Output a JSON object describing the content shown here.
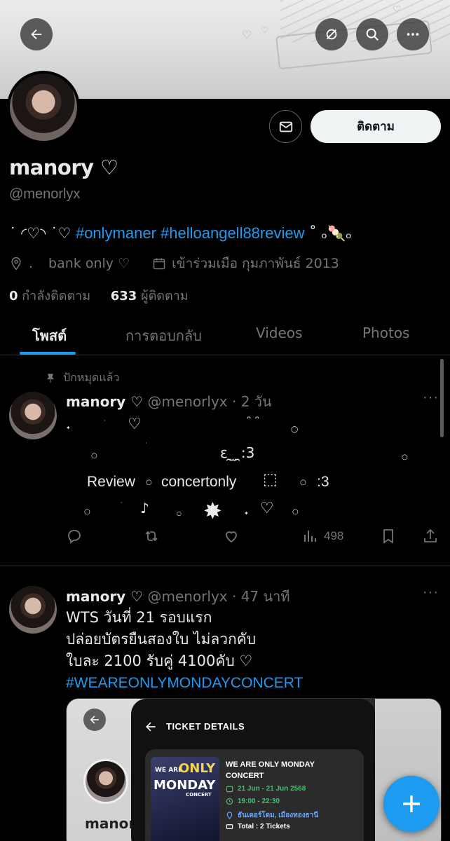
{
  "profile": {
    "name": "manory ♡",
    "handle": "@menorlyx",
    "bio_prefix": "˙ ◜♡◝ ˙♡ ",
    "bio_tag": "#onlymaner #helloangell88review",
    "bio_suffix": " ˚ ₒ🍡ₒ",
    "location": "bank only ♡",
    "joined": "เข้าร่วมเมือ กุมภาพันธ์ 2013",
    "following_count": "0",
    "following_label": "กำลังติดตาม",
    "followers_count": "633",
    "followers_label": "ผู้ติดตาม"
  },
  "buttons": {
    "follow": "ติดตาม"
  },
  "tabs": [
    {
      "label": "โพสต์",
      "active": true
    },
    {
      "label": "การตอบกลับ",
      "active": false
    },
    {
      "label": "Videos",
      "active": false
    },
    {
      "label": "Photos",
      "active": false
    }
  ],
  "posts": [
    {
      "pinned_label": "ปักหมุดแล้ว",
      "name": "manory ♡",
      "handle_time": "@menorlyx · 2 วัน",
      "deco_line1": "♡",
      "deco_line2": "ε ̯ ̫ ̯:3",
      "text_review": "Review",
      "text_concert": "concertonly",
      "text_end": ":3",
      "deco_line4": "♪",
      "deco_heart": "♡",
      "views": "498"
    },
    {
      "name": "manory ♡",
      "handle_time": "@menorlyx · 47 นาที",
      "lines": [
        "WTS วันที่ 21 รอบแรก",
        "ปล่อยบัตรยืนสองใบ ไม่ลวกคับ",
        "ใบละ 2100 รับคู่ 4100คับ ♡"
      ],
      "hashtag": "#WEAREONLYMONDAYCONCERT",
      "media": {
        "header": "TICKET DETAILS",
        "event_title": "WE ARE ONLY MONDAY CONCERT",
        "dates": "21 Jun - 21 Jun 2568",
        "time": "19:00 - 22:30",
        "venue": "ธันเดอร์โดม, เมืองทองธานี",
        "total": "Total : 2 Tickets",
        "poster_text_1": "WE ARE",
        "poster_text_2": "ONLY",
        "poster_text_3": "MONDAY",
        "poster_text_4": "CONCERT",
        "bg_name": "manory"
      }
    }
  ],
  "colors": {
    "accent": "#1d9bf0",
    "muted": "#71767b",
    "text": "#e7e9ea",
    "divider": "#2f3336",
    "ticket_green": "#3ec46d",
    "ticket_blue": "#6aa8ff"
  },
  "icons": [
    "back-arrow-icon",
    "mute-icon",
    "search-icon",
    "more-icon",
    "message-icon",
    "location-icon",
    "calendar-icon",
    "pin-icon",
    "reply-icon",
    "retweet-icon",
    "like-icon",
    "views-icon",
    "bookmark-icon",
    "share-icon",
    "compose-plus-icon"
  ]
}
